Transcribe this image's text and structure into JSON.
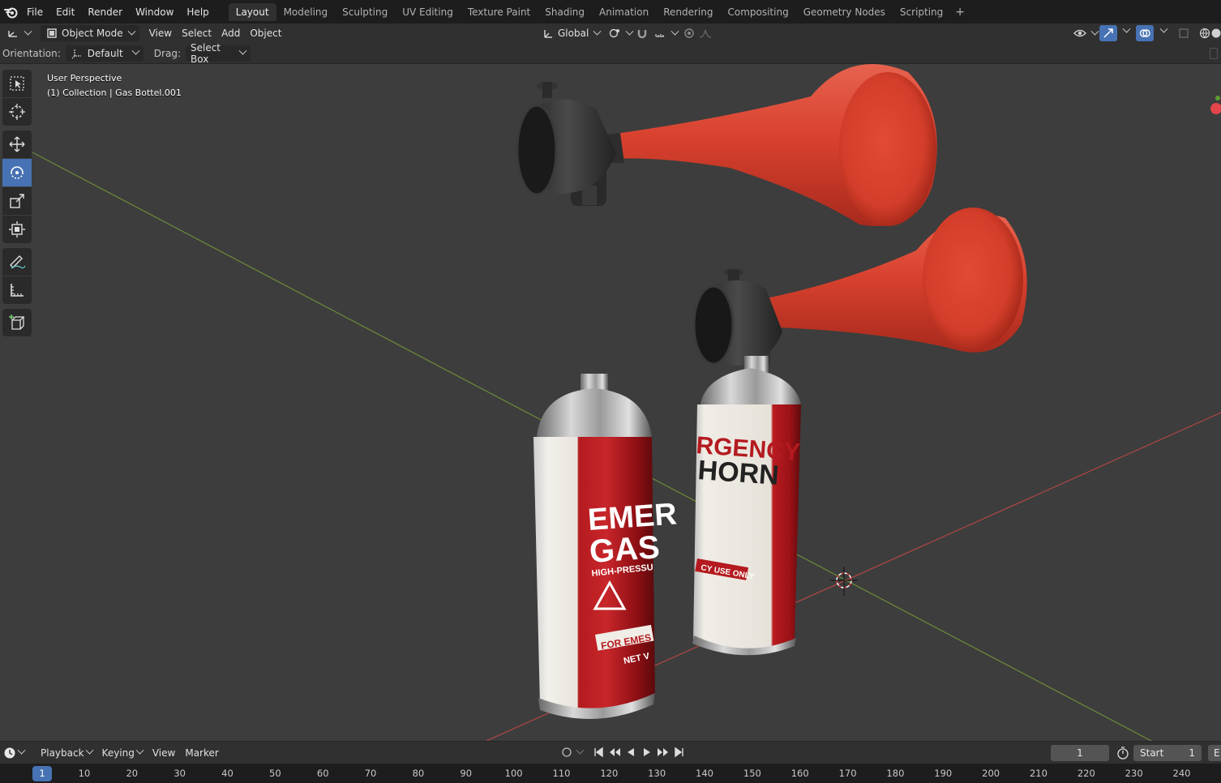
{
  "menu": {
    "items": [
      "File",
      "Edit",
      "Render",
      "Window",
      "Help"
    ]
  },
  "workspaces": {
    "tabs": [
      "Layout",
      "Modeling",
      "Sculpting",
      "UV Editing",
      "Texture Paint",
      "Shading",
      "Animation",
      "Rendering",
      "Compositing",
      "Geometry Nodes",
      "Scripting"
    ],
    "active": "Layout",
    "add": "+"
  },
  "header": {
    "mode": "Object Mode",
    "menus": [
      "View",
      "Select",
      "Add",
      "Object"
    ],
    "transform_orientation": "Global"
  },
  "tool_settings": {
    "orientation_label": "Orientation:",
    "orientation_value": "Default",
    "drag_label": "Drag:",
    "drag_value": "Select Box"
  },
  "viewport": {
    "perspective": "User Perspective",
    "collection": "(1) Collection | Gas Bottel.001",
    "labels": {
      "can1": [
        "EMER",
        "GAS",
        "HIGH-PRESSU",
        "FOR EMES",
        "NET V"
      ],
      "can2": [
        "RGENCY",
        "HORN",
        "CY USE ONLY"
      ]
    }
  },
  "timeline": {
    "menus": [
      "Playback",
      "Keying",
      "View",
      "Marker"
    ],
    "current_frame": "1",
    "start_label": "Start",
    "start_value": "1",
    "ruler_ticks": [
      "10",
      "20",
      "30",
      "40",
      "50",
      "60",
      "70",
      "80",
      "90",
      "100",
      "110",
      "120",
      "130",
      "140",
      "150",
      "160",
      "170",
      "180",
      "190",
      "200",
      "210",
      "220",
      "230",
      "240"
    ],
    "ruler_current": "1"
  },
  "colors": {
    "accent": "#4772b3",
    "horn_red": "#d9412e",
    "can_red": "#b0151c",
    "viewport_bg": "#3d3d3d"
  }
}
